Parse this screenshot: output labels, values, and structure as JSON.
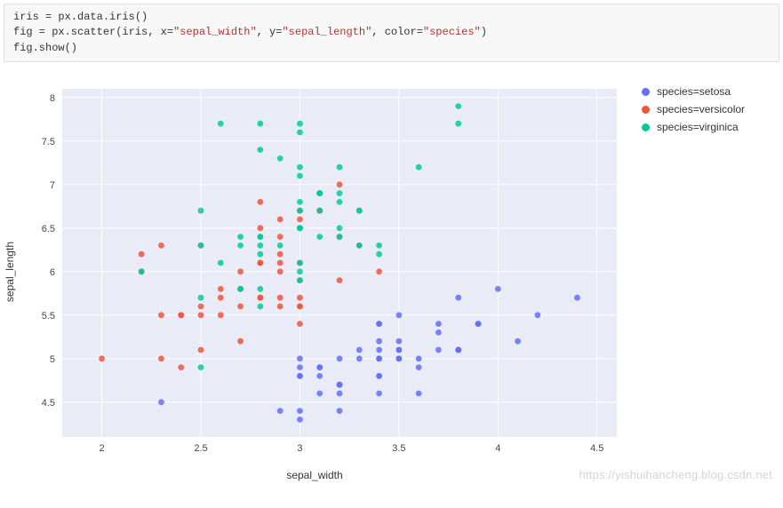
{
  "code": {
    "line1_a": "iris = px.data.iris()",
    "line2_a": "fig = px.scatter(iris, x=",
    "line2_s1": "\"sepal_width\"",
    "line2_b": ", y=",
    "line2_s2": "\"sepal_length\"",
    "line2_c": ", color=",
    "line2_s3": "\"species\"",
    "line2_d": ")",
    "line3_a": "fig.show",
    "line3_b": "()"
  },
  "legend": {
    "items": [
      {
        "label": "species=setosa",
        "color": "#636efa"
      },
      {
        "label": "species=versicolor",
        "color": "#ef553b"
      },
      {
        "label": "species=virginica",
        "color": "#00cc96"
      }
    ]
  },
  "axes": {
    "x": "sepal_width",
    "y": "sepal_length"
  },
  "watermark": "https://yishuihancheng.blog.csdn.net",
  "chart_data": {
    "type": "scatter",
    "xlabel": "sepal_width",
    "ylabel": "sepal_length",
    "xlim": [
      1.8,
      4.6
    ],
    "ylim": [
      4.1,
      8.1
    ],
    "x_ticks": [
      2,
      2.5,
      3,
      3.5,
      4,
      4.5
    ],
    "y_ticks": [
      4.5,
      5,
      5.5,
      6,
      6.5,
      7,
      7.5,
      8
    ],
    "series": [
      {
        "name": "species=setosa",
        "color": "#636efa",
        "points": [
          [
            3.5,
            5.1
          ],
          [
            3.0,
            4.9
          ],
          [
            3.2,
            4.7
          ],
          [
            3.1,
            4.6
          ],
          [
            3.6,
            5.0
          ],
          [
            3.9,
            5.4
          ],
          [
            3.4,
            4.6
          ],
          [
            3.4,
            5.0
          ],
          [
            2.9,
            4.4
          ],
          [
            3.1,
            4.9
          ],
          [
            3.7,
            5.4
          ],
          [
            3.4,
            4.8
          ],
          [
            3.0,
            4.8
          ],
          [
            3.0,
            4.3
          ],
          [
            4.0,
            5.8
          ],
          [
            4.4,
            5.7
          ],
          [
            3.9,
            5.4
          ],
          [
            3.5,
            5.1
          ],
          [
            3.8,
            5.7
          ],
          [
            3.8,
            5.1
          ],
          [
            3.4,
            5.4
          ],
          [
            3.7,
            5.1
          ],
          [
            3.6,
            4.6
          ],
          [
            3.3,
            5.1
          ],
          [
            3.4,
            4.8
          ],
          [
            3.0,
            5.0
          ],
          [
            3.4,
            5.0
          ],
          [
            3.5,
            5.2
          ],
          [
            3.4,
            5.2
          ],
          [
            3.2,
            4.7
          ],
          [
            3.1,
            4.8
          ],
          [
            3.4,
            5.4
          ],
          [
            4.1,
            5.2
          ],
          [
            4.2,
            5.5
          ],
          [
            3.1,
            4.9
          ],
          [
            3.2,
            5.0
          ],
          [
            3.5,
            5.5
          ],
          [
            3.6,
            4.9
          ],
          [
            3.0,
            4.4
          ],
          [
            3.4,
            5.1
          ],
          [
            3.5,
            5.0
          ],
          [
            2.3,
            4.5
          ],
          [
            3.2,
            4.4
          ],
          [
            3.5,
            5.0
          ],
          [
            3.8,
            5.1
          ],
          [
            3.0,
            4.8
          ],
          [
            3.8,
            5.1
          ],
          [
            3.2,
            4.6
          ],
          [
            3.7,
            5.3
          ],
          [
            3.3,
            5.0
          ]
        ]
      },
      {
        "name": "species=versicolor",
        "color": "#ef553b",
        "points": [
          [
            3.2,
            7.0
          ],
          [
            3.2,
            6.4
          ],
          [
            3.1,
            6.9
          ],
          [
            2.3,
            5.5
          ],
          [
            2.8,
            6.5
          ],
          [
            2.8,
            5.7
          ],
          [
            3.3,
            6.3
          ],
          [
            2.4,
            4.9
          ],
          [
            2.9,
            6.6
          ],
          [
            2.7,
            5.2
          ],
          [
            2.0,
            5.0
          ],
          [
            3.0,
            5.9
          ],
          [
            2.2,
            6.0
          ],
          [
            2.9,
            6.1
          ],
          [
            2.9,
            5.6
          ],
          [
            3.1,
            6.7
          ],
          [
            3.0,
            5.6
          ],
          [
            2.7,
            5.8
          ],
          [
            2.2,
            6.2
          ],
          [
            2.5,
            5.6
          ],
          [
            3.2,
            5.9
          ],
          [
            2.8,
            6.1
          ],
          [
            2.5,
            6.3
          ],
          [
            2.8,
            6.1
          ],
          [
            2.9,
            6.4
          ],
          [
            3.0,
            6.6
          ],
          [
            2.8,
            6.8
          ],
          [
            3.0,
            6.7
          ],
          [
            2.9,
            6.0
          ],
          [
            2.6,
            5.7
          ],
          [
            2.4,
            5.5
          ],
          [
            2.4,
            5.5
          ],
          [
            2.7,
            5.8
          ],
          [
            2.7,
            6.0
          ],
          [
            3.0,
            5.4
          ],
          [
            3.4,
            6.0
          ],
          [
            3.1,
            6.7
          ],
          [
            2.3,
            6.3
          ],
          [
            3.0,
            5.6
          ],
          [
            2.5,
            5.5
          ],
          [
            2.6,
            5.5
          ],
          [
            3.0,
            6.1
          ],
          [
            2.6,
            5.8
          ],
          [
            2.3,
            5.0
          ],
          [
            2.7,
            5.6
          ],
          [
            3.0,
            5.7
          ],
          [
            2.9,
            5.7
          ],
          [
            2.9,
            6.2
          ],
          [
            2.5,
            5.1
          ],
          [
            2.8,
            5.7
          ]
        ]
      },
      {
        "name": "species=virginica",
        "color": "#00cc96",
        "points": [
          [
            3.3,
            6.3
          ],
          [
            2.7,
            5.8
          ],
          [
            3.0,
            7.1
          ],
          [
            2.9,
            6.3
          ],
          [
            3.0,
            6.5
          ],
          [
            3.0,
            7.6
          ],
          [
            2.5,
            4.9
          ],
          [
            2.9,
            7.3
          ],
          [
            2.5,
            6.7
          ],
          [
            3.6,
            7.2
          ],
          [
            3.2,
            6.5
          ],
          [
            2.7,
            6.4
          ],
          [
            3.0,
            6.8
          ],
          [
            2.5,
            5.7
          ],
          [
            2.8,
            5.8
          ],
          [
            3.2,
            6.4
          ],
          [
            3.0,
            6.5
          ],
          [
            3.8,
            7.7
          ],
          [
            2.6,
            7.7
          ],
          [
            2.2,
            6.0
          ],
          [
            3.2,
            6.9
          ],
          [
            2.8,
            5.6
          ],
          [
            2.8,
            7.7
          ],
          [
            2.7,
            6.3
          ],
          [
            3.3,
            6.7
          ],
          [
            3.2,
            7.2
          ],
          [
            2.8,
            6.2
          ],
          [
            3.0,
            6.1
          ],
          [
            2.8,
            6.4
          ],
          [
            3.0,
            7.2
          ],
          [
            2.8,
            7.4
          ],
          [
            3.8,
            7.9
          ],
          [
            2.8,
            6.4
          ],
          [
            2.8,
            6.3
          ],
          [
            2.6,
            6.1
          ],
          [
            3.0,
            7.7
          ],
          [
            3.4,
            6.3
          ],
          [
            3.1,
            6.4
          ],
          [
            3.0,
            6.0
          ],
          [
            3.1,
            6.9
          ],
          [
            3.1,
            6.7
          ],
          [
            3.1,
            6.9
          ],
          [
            2.7,
            5.8
          ],
          [
            3.2,
            6.8
          ],
          [
            3.3,
            6.7
          ],
          [
            3.0,
            6.7
          ],
          [
            2.5,
            6.3
          ],
          [
            3.0,
            6.5
          ],
          [
            3.4,
            6.2
          ],
          [
            3.0,
            5.9
          ]
        ]
      }
    ]
  }
}
